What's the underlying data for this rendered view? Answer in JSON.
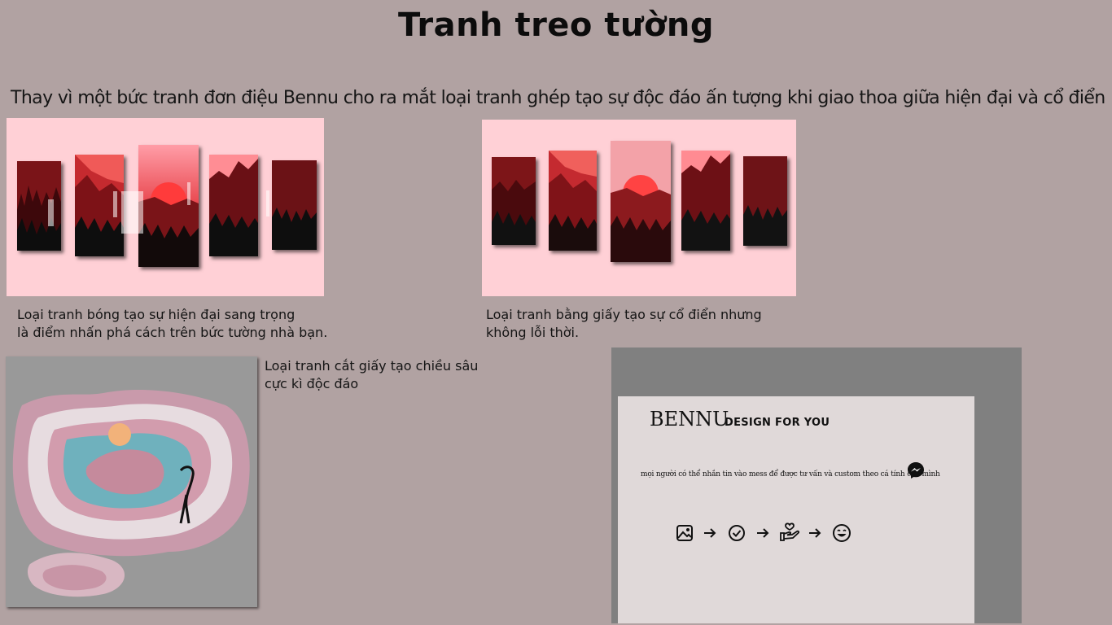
{
  "page": {
    "title": "Tranh treo tường",
    "intro": "Thay vì một bức tranh đơn điệu Bennu cho ra mắt loại tranh ghép tạo sự độc đáo ấn tượng khi giao thoa giữa hiện đại và cổ điển"
  },
  "products": [
    {
      "caption_line1": "Loại tranh bóng tạo sự hiện đại sang trọng",
      "caption_line2": "là điểm nhấn phá cách trên bức tường nhà bạn."
    },
    {
      "caption_line1": "Loại tranh bằng giấy tạo sự cổ điển nhưng",
      "caption_line2": "không lỗi thời."
    },
    {
      "caption_line1": "Loại tranh cắt giấy tạo chiều sâu",
      "caption_line2": "cực kì độc đáo"
    }
  ],
  "contact": {
    "brand": "BENNU",
    "tagline": "DESIGN FOR YOU",
    "message": "mọi người có thể nhắn tin vào mess để được tư vấn và custom theo cá tính của mình",
    "messenger_icon": "messenger-icon",
    "steps": [
      "image-icon",
      "arrow-right-icon",
      "check-circle-icon",
      "arrow-right-icon",
      "hand-heart-icon",
      "arrow-right-icon",
      "smile-icon"
    ]
  },
  "colors": {
    "background": "#b1a2a2",
    "panel_pink": "#ffd0d6",
    "contact_frame": "#808080",
    "contact_card": "#e0d9d9"
  }
}
